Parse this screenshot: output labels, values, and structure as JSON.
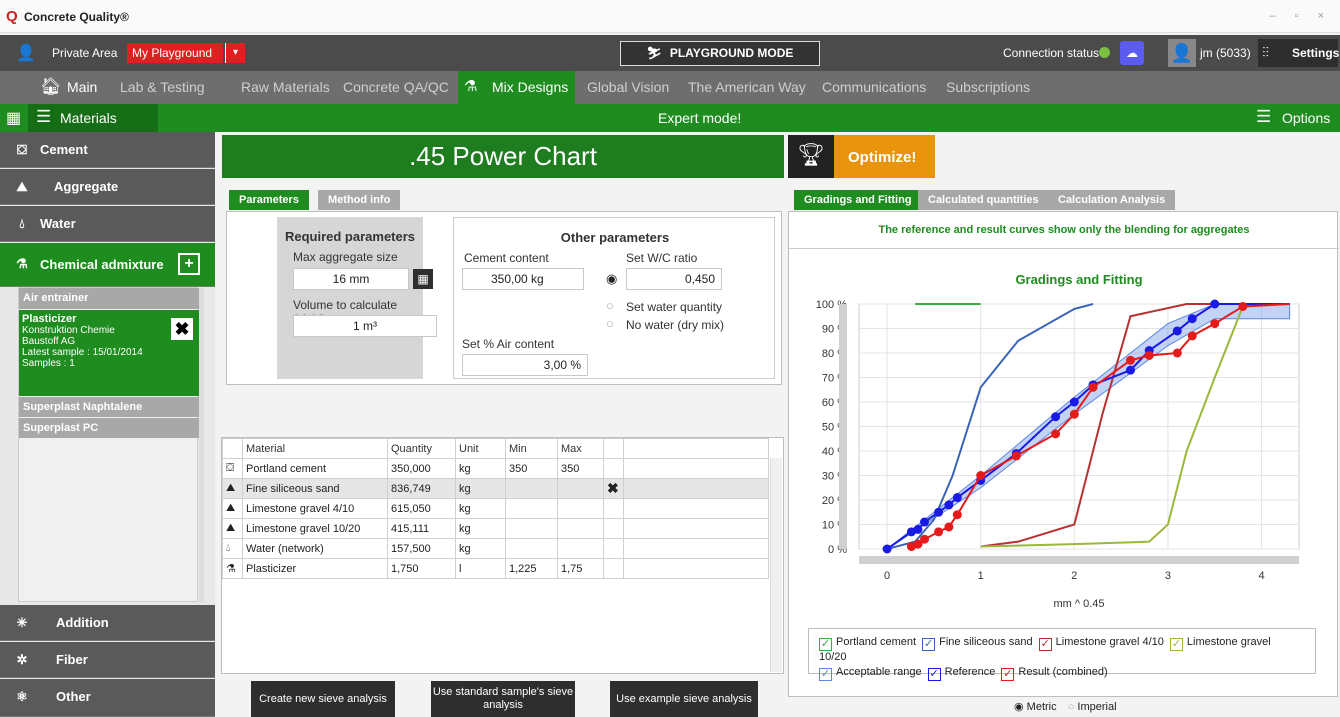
{
  "window": {
    "title": "Concrete Quality®",
    "logo_letter": "Q"
  },
  "topbar": {
    "private_area": "Private Area",
    "workspace": "My Playground",
    "playground_mode": "PLAYGROUND MODE",
    "connection_status": "Connection status",
    "user": "jm (5033)",
    "settings": "Settings"
  },
  "nav": {
    "tabs": [
      {
        "label": "Main"
      },
      {
        "label": "Lab & Testing"
      },
      {
        "label": "Raw Materials"
      },
      {
        "label": "Concrete QA/QC"
      },
      {
        "label": "Mix Designs"
      },
      {
        "label": "Global Vision"
      },
      {
        "label": "The American Way"
      },
      {
        "label": "Communications"
      },
      {
        "label": "Subscriptions"
      }
    ],
    "active": "Mix Designs"
  },
  "greenbar": {
    "materials": "Materials",
    "mode": "Expert mode!",
    "options": "Options"
  },
  "sidebar": {
    "items": [
      {
        "label": "Cement"
      },
      {
        "label": "Aggregate"
      },
      {
        "label": "Water"
      },
      {
        "label": "Chemical admixture"
      },
      {
        "label": "Addition"
      },
      {
        "label": "Fiber"
      },
      {
        "label": "Other"
      }
    ],
    "admixtures": {
      "air": "Air entrainer",
      "plasticizer_title": "Plasticizer",
      "plasticizer_lines": [
        "Konstruktion Chemie",
        "Baustoff AG",
        "Latest sample :  15/01/2014",
        "Samples :  1"
      ],
      "naphtalene": "Superplast Naphtalene",
      "pc": "Superplast PC"
    }
  },
  "main": {
    "title": ".45 Power Chart",
    "tabs": {
      "parameters": "Parameters",
      "method": "Method info"
    },
    "required": {
      "heading": "Required parameters",
      "max_agg_label": "Max aggregate size",
      "max_agg_value": "16 mm",
      "volume_label": "Volume to calculate (yield)",
      "volume_value": "1 m³"
    },
    "other": {
      "heading": "Other parameters",
      "cement_label": "Cement content",
      "cement_value": "350,00 kg",
      "wc_label": "Set W/C ratio",
      "wc_value": "0,450",
      "water_qty": "Set water quantity",
      "no_water": "No water (dry mix)",
      "air_label": "Set % Air content",
      "air_value": "3,00 %"
    }
  },
  "table": {
    "headers": [
      "Material",
      "Quantity",
      "Unit",
      "Min",
      "Max"
    ],
    "rows": [
      {
        "material": "Portland cement",
        "quantity": "350,000",
        "unit": "kg",
        "min": "350",
        "max": "350"
      },
      {
        "material": "Fine siliceous sand",
        "quantity": "836,749",
        "unit": "kg",
        "min": "",
        "max": ""
      },
      {
        "material": "Limestone gravel 4/10",
        "quantity": "615,050",
        "unit": "kg",
        "min": "",
        "max": ""
      },
      {
        "material": "Limestone gravel 10/20",
        "quantity": "415,111",
        "unit": "kg",
        "min": "",
        "max": ""
      },
      {
        "material": "Water (network)",
        "quantity": "157,500",
        "unit": "kg",
        "min": "",
        "max": ""
      },
      {
        "material": "Plasticizer",
        "quantity": "1,750",
        "unit": "l",
        "min": "1,225",
        "max": "1,75"
      }
    ]
  },
  "buttons": {
    "create": "Create new sieve analysis",
    "standard": "Use standard sample's sieve analysis",
    "example": "Use example sieve analysis"
  },
  "right": {
    "optimize": "Optimize!",
    "tabs": [
      "Gradings and Fitting",
      "Calculated quantities",
      "Calculation Analysis"
    ],
    "note": "The reference and result curves show only the blending for aggregates",
    "metric": "Metric",
    "imperial": "Imperial"
  },
  "chart_data": {
    "type": "line",
    "title": "Gradings and Fitting",
    "xlabel": "mm ^ 0.45",
    "ylabel": "",
    "xlim": [
      -0.3,
      4.4
    ],
    "ylim": [
      0,
      100
    ],
    "xticks": [
      "0",
      "1",
      "2",
      "3",
      "4"
    ],
    "yticks": [
      "0 %",
      "10 %",
      "20 %",
      "30 %",
      "40 %",
      "50 %",
      "60 %",
      "70 %",
      "80 %",
      "90 %",
      "100 %"
    ],
    "series": [
      {
        "name": "Portland cement",
        "color": "#3cae3c",
        "x": [
          0.3,
          1.0
        ],
        "y": [
          100,
          100
        ]
      },
      {
        "name": "Fine siliceous sand",
        "color": "#3a64b8",
        "x": [
          0,
          0.3,
          0.5,
          0.7,
          1.0,
          1.4,
          2.0,
          2.2
        ],
        "y": [
          0,
          3,
          12,
          30,
          66,
          85,
          98,
          100
        ]
      },
      {
        "name": "Limestone gravel 4/10",
        "color": "#b83030",
        "x": [
          1.0,
          1.4,
          2.0,
          2.3,
          2.6,
          3.2,
          4.3
        ],
        "y": [
          1,
          3,
          10,
          55,
          95,
          100,
          100
        ]
      },
      {
        "name": "Limestone gravel 10/20",
        "color": "#9ab83a",
        "x": [
          1.0,
          2.0,
          2.8,
          3.0,
          3.2,
          3.5,
          3.8,
          4.3
        ],
        "y": [
          1,
          2,
          3,
          10,
          40,
          70,
          99,
          100
        ]
      },
      {
        "name": "Reference",
        "color": "#1a1ae6",
        "x": [
          0,
          0.26,
          0.33,
          0.4,
          0.55,
          0.66,
          0.75,
          1.0,
          1.38,
          1.8,
          2.0,
          2.2,
          2.6,
          2.8,
          3.1,
          3.26,
          3.5,
          4.3
        ],
        "y": [
          0,
          7,
          8,
          11,
          15,
          18,
          21,
          28,
          39,
          54,
          60,
          67,
          73,
          81,
          89,
          94,
          100,
          100
        ]
      },
      {
        "name": "Result (combined)",
        "color": "#e61a1a",
        "x": [
          0.26,
          0.33,
          0.4,
          0.55,
          0.66,
          0.75,
          1.0,
          1.38,
          1.8,
          2.0,
          2.2,
          2.6,
          2.8,
          3.1,
          3.26,
          3.5,
          3.8,
          4.3
        ],
        "y": [
          1,
          2,
          4,
          7,
          9,
          14,
          30,
          38,
          47,
          55,
          66,
          77,
          79,
          80,
          87,
          92,
          99,
          100
        ]
      }
    ],
    "band": {
      "name": "Acceptable range",
      "x": [
        0,
        1.0,
        2.0,
        3.0,
        3.5,
        4.3
      ],
      "low": [
        0,
        25,
        55,
        83,
        94,
        94
      ],
      "high": [
        0,
        30,
        62,
        92,
        100,
        100
      ]
    },
    "legend": [
      "Portland cement",
      "Fine siliceous sand",
      "Limestone gravel 4/10",
      "Limestone gravel 10/20",
      "Acceptable range",
      "Reference",
      "Result (combined)"
    ]
  }
}
